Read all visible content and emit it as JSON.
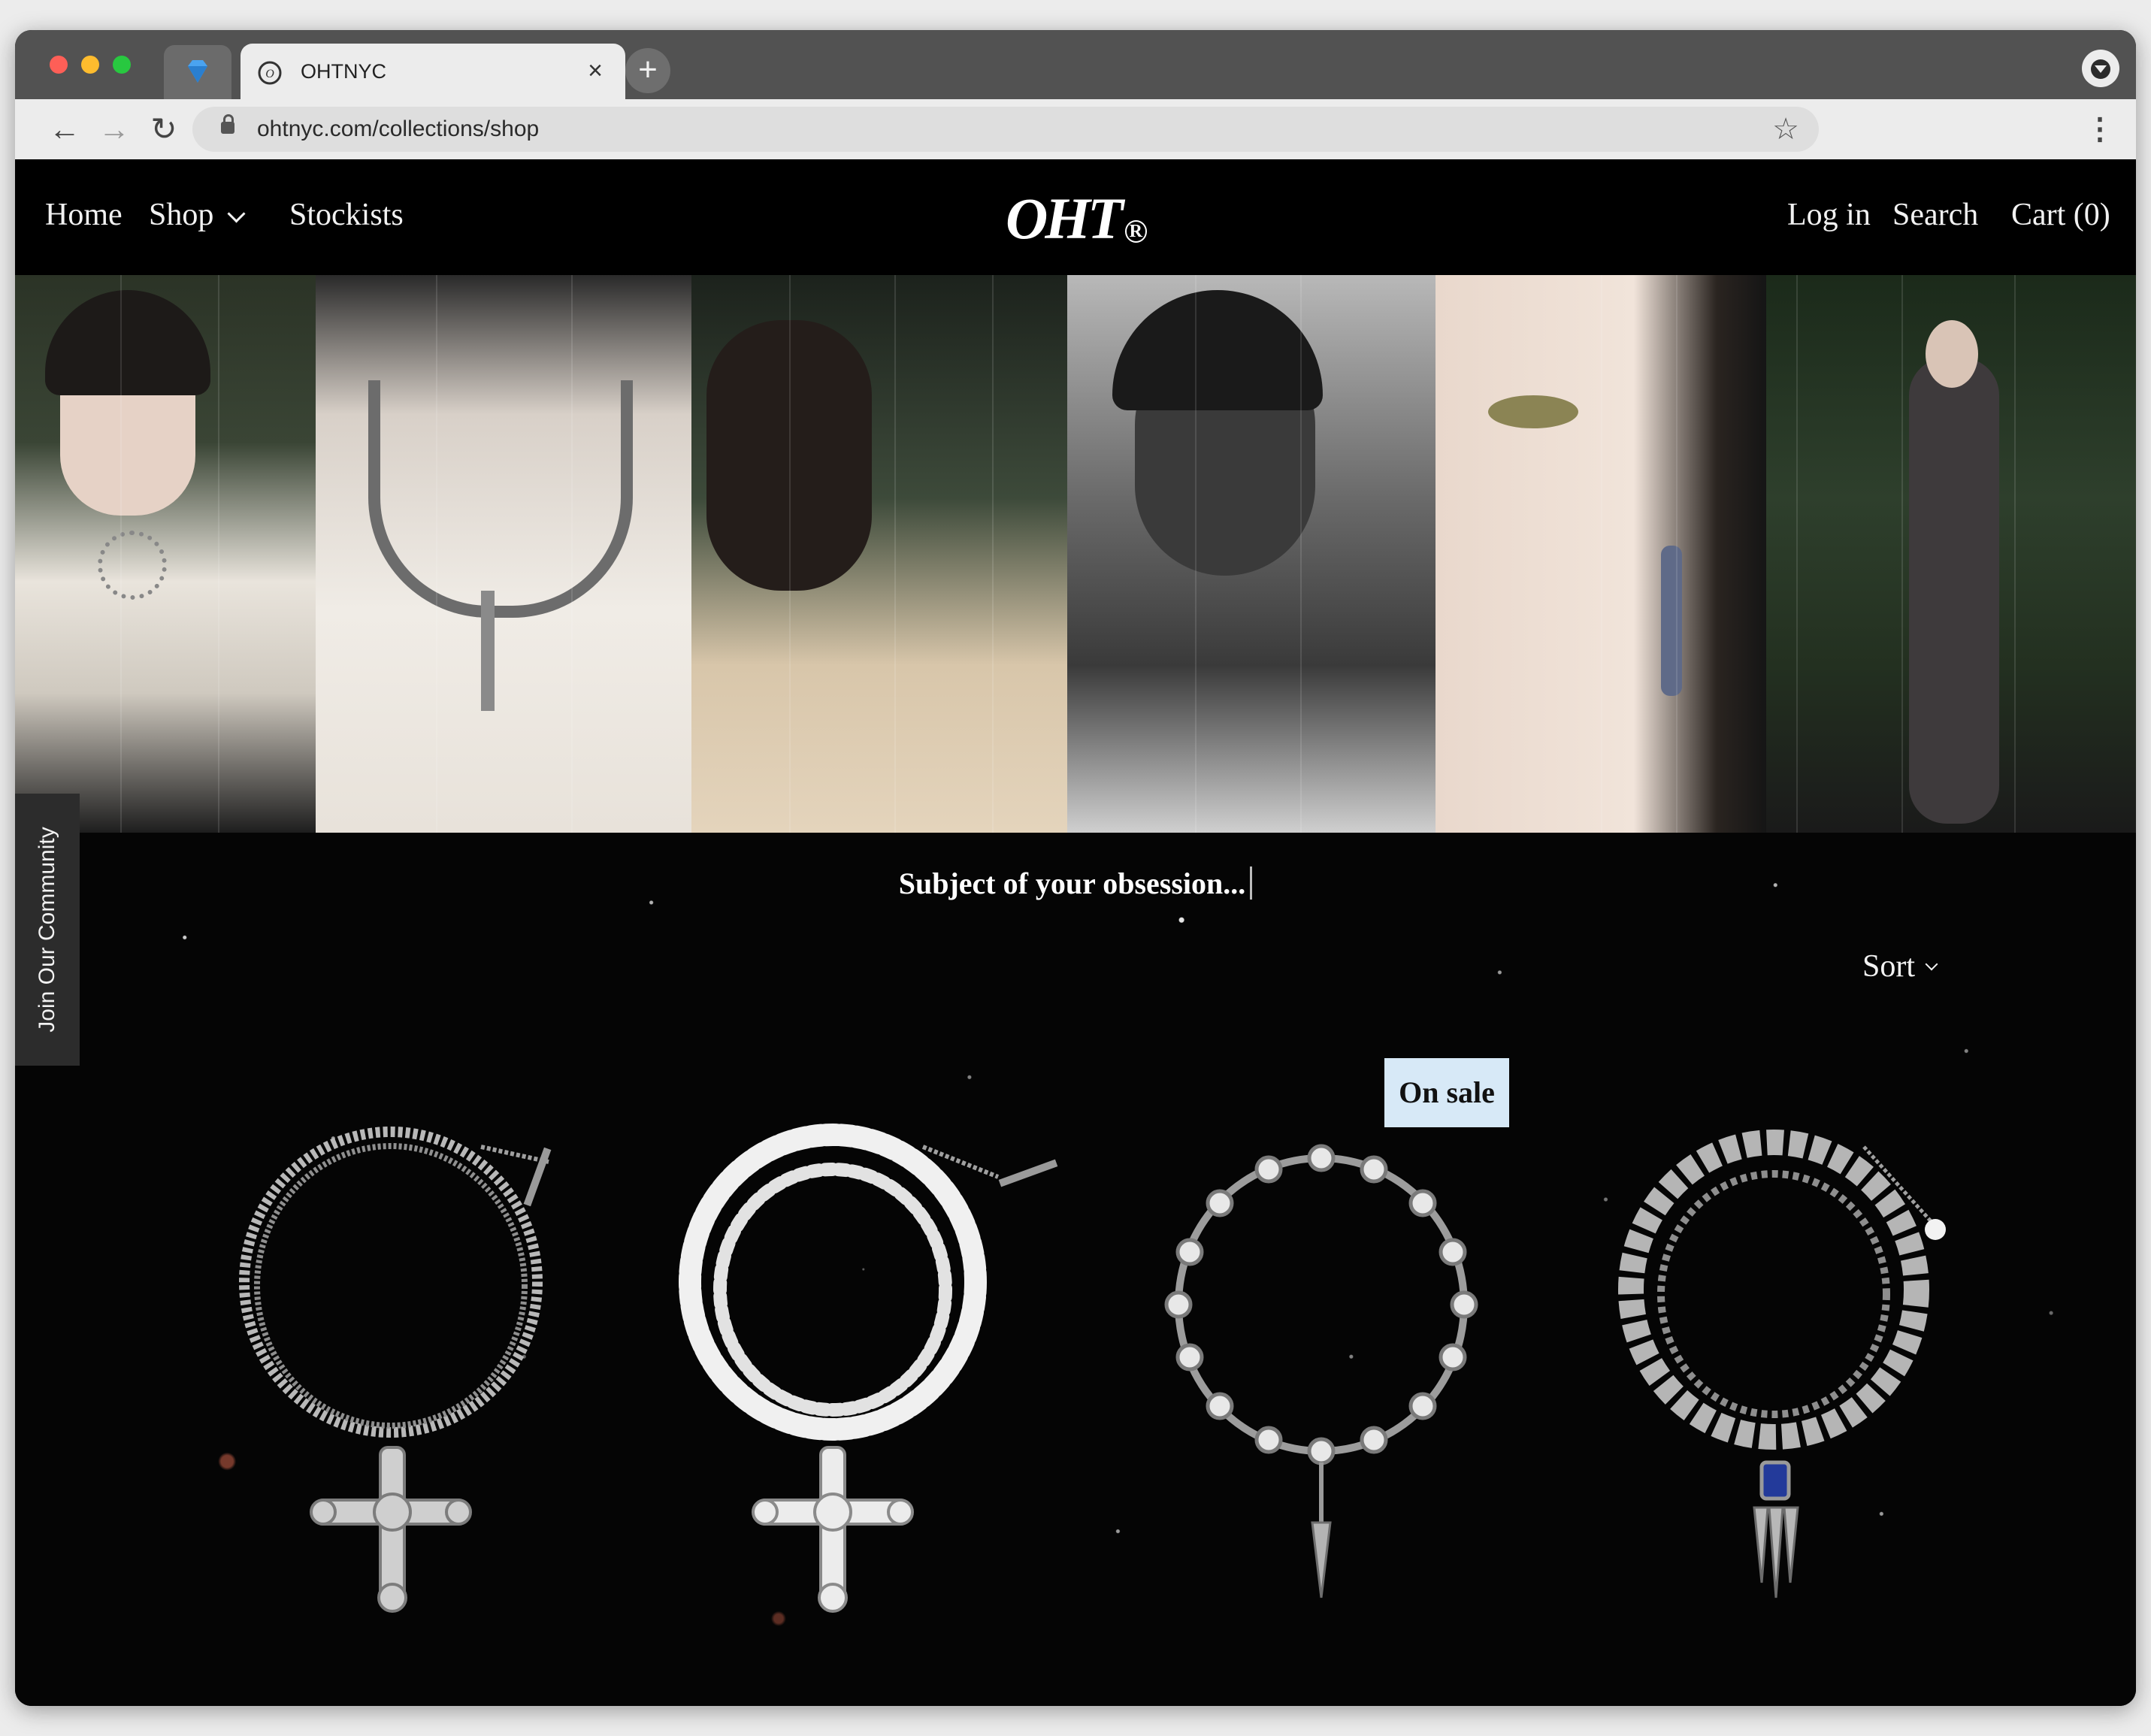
{
  "browser": {
    "tab_title": "OHTNYC",
    "new_tab_label": "+",
    "close_label": "×",
    "url": "ohtnyc.com/collections/shop",
    "back_label": "←",
    "forward_label": "→",
    "reload_label": "↻",
    "star_label": "☆",
    "menu_label": "⋮"
  },
  "nav": {
    "home": "Home",
    "shop": "Shop",
    "stockists": "Stockists",
    "logo": "OHT",
    "logo_mark": "R",
    "login": "Log in",
    "search": "Search",
    "cart": "Cart (0)"
  },
  "main": {
    "headline": "Subject of your obsession...",
    "sort_label": "Sort",
    "community_tab": "Join Our Community",
    "sale_badge": "On sale"
  },
  "products": [
    {
      "name": "chain-cross-necklace",
      "icon": "cross-pendant-chain-necklace-image"
    },
    {
      "name": "pearl-cross-necklace",
      "icon": "pearl-cross-necklace-image"
    },
    {
      "name": "crystal-spike-necklace",
      "icon": "crystal-spike-necklace-image",
      "on_sale": true
    },
    {
      "name": "link-sapphire-necklace",
      "icon": "link-sapphire-pendant-necklace-image"
    }
  ],
  "colors": {
    "page_bg": "#000000",
    "nav_text": "#f2f2f2",
    "sale_badge_bg": "#d7e9f7",
    "community_tab_bg": "#2c2c2c"
  }
}
